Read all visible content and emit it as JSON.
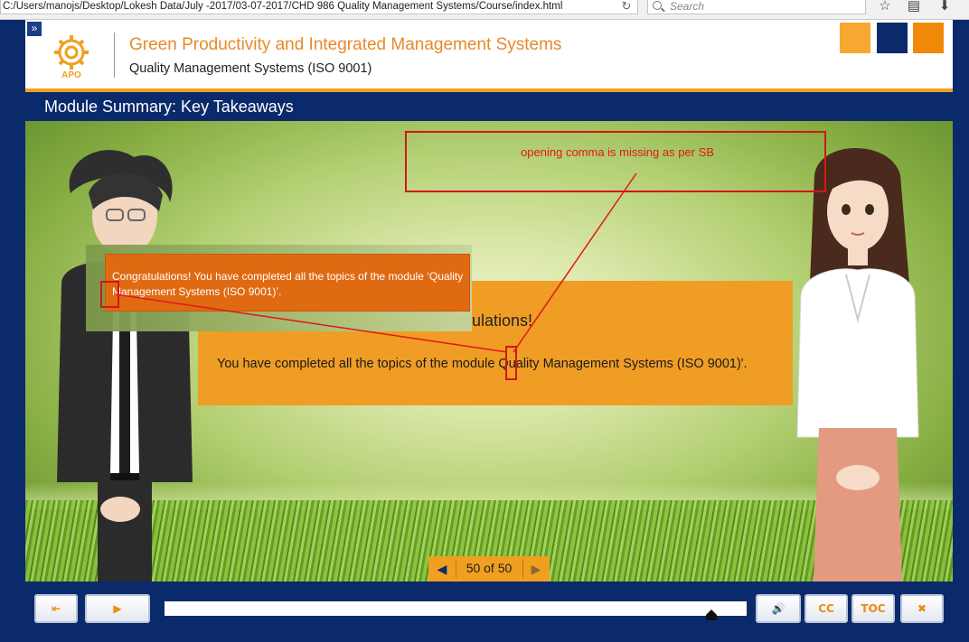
{
  "browser": {
    "url": "C:/Users/manojs/Desktop/Lokesh Data/July -2017/03-07-2017/CHD 986 Quality Management Systems/Course/index.html",
    "search_placeholder": "Search",
    "reload_icon": "reload-icon",
    "toolbar_icons": [
      "star-icon",
      "reading-list-icon",
      "download-icon"
    ]
  },
  "header": {
    "logo_text": "APO",
    "title": "Green Productivity and Integrated Management Systems",
    "subtitle": "Quality Management Systems (ISO 9001)",
    "color_squares": [
      "#f7a832",
      "#0b2a6b",
      "#f0890a"
    ]
  },
  "module": {
    "title": "Module Summary: Key Takeaways"
  },
  "panel": {
    "heading": "atulations!",
    "body": "You have completed all the topics of the module Quality Management Systems (ISO 9001)'."
  },
  "popup": {
    "text": "Congratulations! You  have completed  all the topics of the module ‘Quality Management Systems (ISO 9001)’."
  },
  "annotation": {
    "comment": "opening comma is missing as per SB"
  },
  "page_nav": {
    "current": 50,
    "total": 50,
    "label": "50 of 50"
  },
  "footer": {
    "cc_label": "CC",
    "toc_label": "TOC",
    "progress_fraction": 0.94
  },
  "colors": {
    "accent_orange": "#f0a020",
    "brand_navy": "#0b2a6b",
    "annotation_red": "#d01818"
  }
}
